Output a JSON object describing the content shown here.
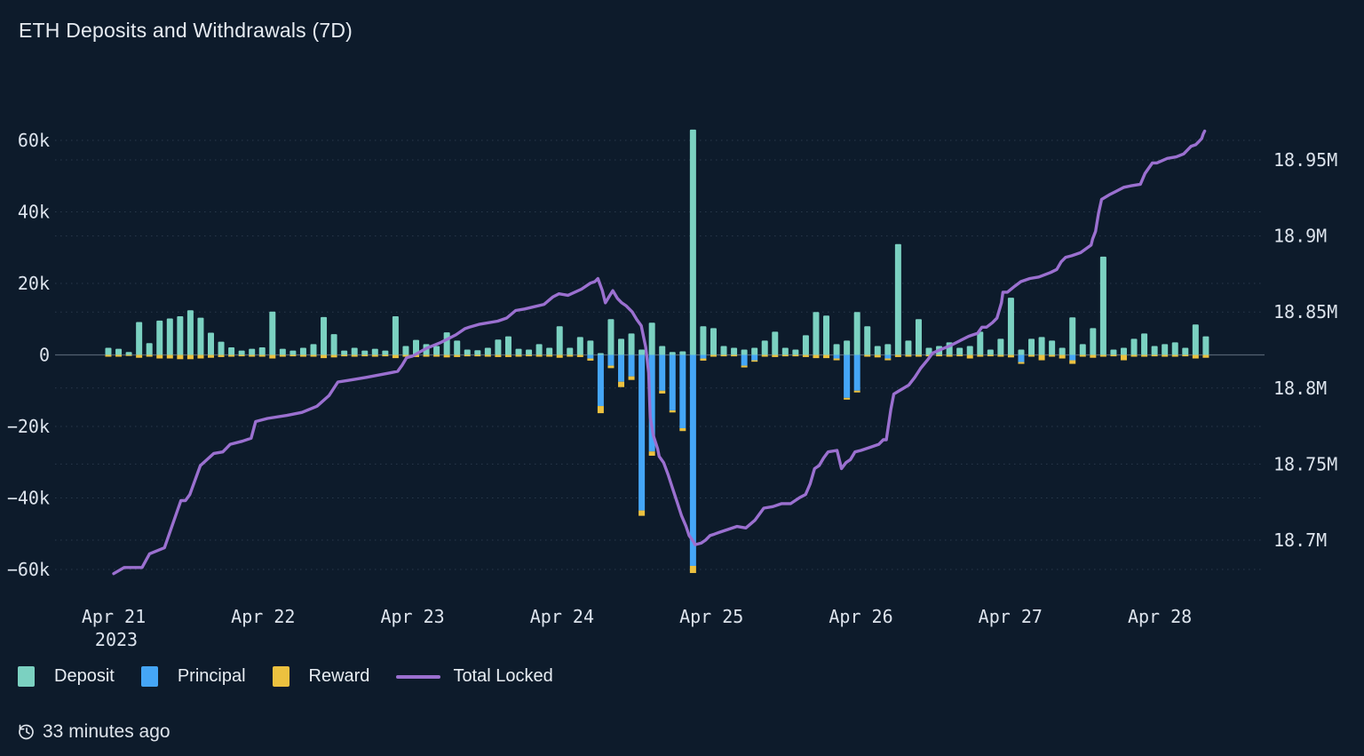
{
  "title": "ETH Deposits and Withdrawals (7D)",
  "footer": {
    "icon": "history-clock-icon",
    "updated": "33 minutes ago"
  },
  "legend": [
    {
      "label": "Deposit",
      "color": "#7bd1c1",
      "type": "square"
    },
    {
      "label": "Principal",
      "color": "#45a6f6",
      "type": "square"
    },
    {
      "label": "Reward",
      "color": "#ecc13f",
      "type": "square"
    },
    {
      "label": "Total Locked",
      "color": "#9b70d0",
      "type": "line"
    }
  ],
  "colors": {
    "background": "#0d1b2b",
    "deposit": "#7bd1c1",
    "principal": "#45a6f6",
    "reward": "#ecc13f",
    "total_locked": "#9b70d0",
    "grid": "#7c90aa",
    "zero_line": "#9aa7b6",
    "axis_text": "#dde4ed"
  },
  "chart_data": {
    "type": "bar",
    "subtype": "stacked-bars-with-line",
    "title": "ETH Deposits and Withdrawals (7D)",
    "x_axis": {
      "tick_labels": [
        "Apr 21",
        "Apr 22",
        "Apr 23",
        "Apr 24",
        "Apr 25",
        "Apr 26",
        "Apr 27",
        "Apr 28"
      ],
      "year_label": "2023"
    },
    "left_axis": {
      "unit": "ETH (thousands)",
      "range": [
        -60,
        60
      ],
      "ticks": [
        {
          "label": "60k",
          "value": 60
        },
        {
          "label": "40k",
          "value": 40
        },
        {
          "label": "20k",
          "value": 20
        },
        {
          "label": "0",
          "value": 0
        },
        {
          "label": "−20k",
          "value": -20
        },
        {
          "label": "−40k",
          "value": -40
        },
        {
          "label": "−60k",
          "value": -60
        }
      ]
    },
    "right_axis": {
      "unit": "ETH total locked (millions)",
      "range": [
        18.7,
        18.95
      ],
      "ticks": [
        {
          "label": "18.95M",
          "value": 18.95
        },
        {
          "label": "18.9M",
          "value": 18.9
        },
        {
          "label": "18.85M",
          "value": 18.85
        },
        {
          "label": "18.8M",
          "value": 18.8
        },
        {
          "label": "18.75M",
          "value": 18.75
        },
        {
          "label": "18.7M",
          "value": 18.7
        }
      ]
    },
    "bars": {
      "t0": -0.0357,
      "dt": 0.06863,
      "units": "k ETH",
      "deposit": [
        2,
        1.7,
        0.8,
        9.2,
        3.3,
        9.6,
        10.2,
        10.8,
        12.5,
        10.4,
        6.2,
        3.7,
        2.1,
        1.2,
        1.7,
        2.1,
        12.1,
        1.7,
        1.2,
        2,
        3,
        10.6,
        5.8,
        1.2,
        2,
        1.2,
        1.7,
        1.2,
        10.8,
        2.5,
        4.2,
        3,
        2.5,
        6.3,
        4,
        1.5,
        1.3,
        2,
        4.3,
        5.2,
        1.7,
        1.5,
        3,
        2,
        8,
        2,
        5,
        4,
        0.5,
        10,
        4.5,
        6,
        1.5,
        9,
        2.5,
        0.8,
        1,
        63,
        8,
        7.5,
        2.5,
        2,
        1.5,
        2,
        4,
        6.5,
        2,
        1.5,
        5.5,
        12,
        11,
        3,
        4,
        12,
        8,
        2.5,
        3,
        31,
        4,
        10,
        2,
        2.5,
        3.5,
        2,
        2.5,
        6.5,
        1.5,
        4.5,
        16,
        1.5,
        4.5,
        5,
        4,
        2,
        10.5,
        3,
        7.5,
        27.5,
        1.5,
        2,
        4.5,
        6,
        2.5,
        3,
        3.5,
        2,
        8.5,
        5.2
      ],
      "principal": [
        0,
        0,
        0,
        0,
        0,
        0,
        0,
        0,
        0,
        0,
        0,
        0,
        0,
        0,
        0,
        0,
        0,
        0,
        0,
        0,
        0,
        0,
        0,
        0,
        0,
        0,
        0,
        0,
        0,
        0,
        0,
        0,
        0,
        0,
        0,
        0,
        0,
        0,
        0,
        0,
        0,
        0,
        0,
        0,
        0,
        0,
        0,
        -1,
        -14.3,
        -3,
        -7.5,
        -6,
        -43.5,
        -27,
        -10,
        -15.5,
        -20.5,
        -59,
        -1,
        0,
        0,
        0,
        -3,
        -1.5,
        0,
        0,
        0,
        0,
        0,
        0,
        0,
        -1,
        -12,
        -10,
        0,
        0,
        -1,
        0,
        0,
        0,
        0,
        0,
        0,
        0,
        0,
        0,
        0,
        0,
        0,
        -2,
        0,
        0,
        0,
        0,
        -1.5,
        0,
        0,
        0,
        0,
        0,
        0,
        0,
        0,
        0,
        0,
        0,
        0,
        0
      ],
      "reward": [
        -0.5,
        -0.5,
        -0.3,
        -0.8,
        -0.5,
        -1,
        -1,
        -1.2,
        -1.2,
        -1,
        -0.8,
        -0.6,
        -0.5,
        -0.4,
        -0.5,
        -0.5,
        -1,
        -0.5,
        -0.4,
        -0.5,
        -0.5,
        -0.9,
        -0.7,
        -0.4,
        -0.5,
        -0.4,
        -0.5,
        -0.4,
        -0.9,
        -0.5,
        -0.6,
        -0.5,
        -0.5,
        -0.7,
        -0.6,
        -0.4,
        -0.4,
        -0.5,
        -0.6,
        -0.6,
        -0.5,
        -0.4,
        -0.5,
        -0.5,
        -0.8,
        -0.5,
        -0.6,
        -0.6,
        -2,
        -0.7,
        -1.5,
        -1,
        -1.5,
        -1.2,
        -0.8,
        -0.6,
        -0.8,
        -2,
        -0.6,
        -0.5,
        -0.4,
        -0.4,
        -0.5,
        -0.4,
        -0.5,
        -0.6,
        -0.4,
        -0.4,
        -0.6,
        -0.9,
        -0.9,
        -0.5,
        -0.5,
        -0.5,
        -0.5,
        -0.7,
        -0.5,
        -0.6,
        -0.5,
        -0.5,
        -0.4,
        -0.4,
        -0.5,
        -0.4,
        -1,
        -0.5,
        -0.4,
        -0.5,
        -0.7,
        -0.5,
        -0.5,
        -1.5,
        -0.5,
        -1,
        -1,
        -0.5,
        -0.8,
        -0.5,
        -0.4,
        -1.5,
        -0.5,
        -0.5,
        -0.4,
        -0.5,
        -0.5,
        -0.4,
        -1,
        -0.8
      ]
    },
    "total_locked": {
      "name": "Total Locked",
      "units": "M ETH",
      "points": [
        [
          0,
          18.678
        ],
        [
          0.07,
          18.682
        ],
        [
          0.19,
          18.682
        ],
        [
          0.24,
          18.691
        ],
        [
          0.34,
          18.695
        ],
        [
          0.45,
          18.726
        ],
        [
          0.48,
          18.726
        ],
        [
          0.51,
          18.73
        ],
        [
          0.58,
          18.749
        ],
        [
          0.67,
          18.757
        ],
        [
          0.73,
          18.758
        ],
        [
          0.78,
          18.763
        ],
        [
          0.86,
          18.765
        ],
        [
          0.92,
          18.767
        ],
        [
          0.95,
          18.778
        ],
        [
          1.03,
          18.78
        ],
        [
          1.16,
          18.782
        ],
        [
          1.26,
          18.784
        ],
        [
          1.36,
          18.788
        ],
        [
          1.44,
          18.795
        ],
        [
          1.5,
          18.804
        ],
        [
          1.57,
          18.805
        ],
        [
          1.69,
          18.807
        ],
        [
          1.85,
          18.81
        ],
        [
          1.9,
          18.811
        ],
        [
          1.93,
          18.815
        ],
        [
          1.96,
          18.82
        ],
        [
          2,
          18.821
        ],
        [
          2.09,
          18.826
        ],
        [
          2.19,
          18.83
        ],
        [
          2.29,
          18.835
        ],
        [
          2.35,
          18.839
        ],
        [
          2.38,
          18.84
        ],
        [
          2.45,
          18.842
        ],
        [
          2.57,
          18.844
        ],
        [
          2.63,
          18.846
        ],
        [
          2.69,
          18.851
        ],
        [
          2.75,
          18.852
        ],
        [
          2.88,
          18.855
        ],
        [
          2.94,
          18.86
        ],
        [
          2.98,
          18.862
        ],
        [
          3.04,
          18.861
        ],
        [
          3.13,
          18.865
        ],
        [
          3.19,
          18.869
        ],
        [
          3.22,
          18.87
        ],
        [
          3.24,
          18.872
        ],
        [
          3.27,
          18.864
        ],
        [
          3.29,
          18.856
        ],
        [
          3.32,
          18.861
        ],
        [
          3.34,
          18.864
        ],
        [
          3.37,
          18.859
        ],
        [
          3.4,
          18.856
        ],
        [
          3.43,
          18.854
        ],
        [
          3.47,
          18.85
        ],
        [
          3.5,
          18.845
        ],
        [
          3.53,
          18.841
        ],
        [
          3.56,
          18.827
        ],
        [
          3.58,
          18.81
        ],
        [
          3.59,
          18.781
        ],
        [
          3.61,
          18.769
        ],
        [
          3.64,
          18.76
        ],
        [
          3.65,
          18.755
        ],
        [
          3.68,
          18.751
        ],
        [
          3.71,
          18.743
        ],
        [
          3.74,
          18.734
        ],
        [
          3.77,
          18.725
        ],
        [
          3.8,
          18.716
        ],
        [
          3.83,
          18.709
        ],
        [
          3.85,
          18.703
        ],
        [
          3.88,
          18.699
        ],
        [
          3.89,
          18.697
        ],
        [
          3.93,
          18.698
        ],
        [
          3.96,
          18.7
        ],
        [
          3.99,
          18.703
        ],
        [
          4.02,
          18.704
        ],
        [
          4.05,
          18.705
        ],
        [
          4.11,
          18.707
        ],
        [
          4.17,
          18.709
        ],
        [
          4.23,
          18.708
        ],
        [
          4.29,
          18.713
        ],
        [
          4.35,
          18.721
        ],
        [
          4.41,
          18.722
        ],
        [
          4.47,
          18.724
        ],
        [
          4.53,
          18.724
        ],
        [
          4.59,
          18.728
        ],
        [
          4.63,
          18.73
        ],
        [
          4.66,
          18.737
        ],
        [
          4.69,
          18.747
        ],
        [
          4.72,
          18.749
        ],
        [
          4.75,
          18.754
        ],
        [
          4.78,
          18.758
        ],
        [
          4.84,
          18.759
        ],
        [
          4.87,
          18.747
        ],
        [
          4.9,
          18.751
        ],
        [
          4.93,
          18.753
        ],
        [
          4.96,
          18.758
        ],
        [
          5,
          18.759
        ],
        [
          5.06,
          18.761
        ],
        [
          5.12,
          18.763
        ],
        [
          5.15,
          18.766
        ],
        [
          5.17,
          18.766
        ],
        [
          5.2,
          18.786
        ],
        [
          5.22,
          18.796
        ],
        [
          5.27,
          18.799
        ],
        [
          5.32,
          18.802
        ],
        [
          5.36,
          18.807
        ],
        [
          5.4,
          18.813
        ],
        [
          5.45,
          18.819
        ],
        [
          5.48,
          18.823
        ],
        [
          5.55,
          18.826
        ],
        [
          5.6,
          18.828
        ],
        [
          5.66,
          18.831
        ],
        [
          5.72,
          18.834
        ],
        [
          5.75,
          18.835
        ],
        [
          5.78,
          18.836
        ],
        [
          5.81,
          18.84
        ],
        [
          5.84,
          18.84
        ],
        [
          5.88,
          18.843
        ],
        [
          5.91,
          18.846
        ],
        [
          5.94,
          18.856
        ],
        [
          5.95,
          18.863
        ],
        [
          5.98,
          18.863
        ],
        [
          6.03,
          18.867
        ],
        [
          6.07,
          18.87
        ],
        [
          6.13,
          18.872
        ],
        [
          6.19,
          18.873
        ],
        [
          6.27,
          18.876
        ],
        [
          6.31,
          18.878
        ],
        [
          6.34,
          18.883
        ],
        [
          6.37,
          18.886
        ],
        [
          6.41,
          18.887
        ],
        [
          6.47,
          18.889
        ],
        [
          6.54,
          18.894
        ],
        [
          6.55,
          18.898
        ],
        [
          6.57,
          18.903
        ],
        [
          6.59,
          18.915
        ],
        [
          6.61,
          18.924
        ],
        [
          6.66,
          18.927
        ],
        [
          6.7,
          18.929
        ],
        [
          6.76,
          18.932
        ],
        [
          6.81,
          18.933
        ],
        [
          6.87,
          18.934
        ],
        [
          6.9,
          18.941
        ],
        [
          6.95,
          18.948
        ],
        [
          6.98,
          18.948
        ],
        [
          7.05,
          18.951
        ],
        [
          7.11,
          18.952
        ],
        [
          7.16,
          18.954
        ],
        [
          7.21,
          18.959
        ],
        [
          7.24,
          18.96
        ],
        [
          7.26,
          18.962
        ],
        [
          7.28,
          18.964
        ],
        [
          7.29,
          18.967
        ],
        [
          7.3,
          18.969
        ]
      ]
    }
  }
}
